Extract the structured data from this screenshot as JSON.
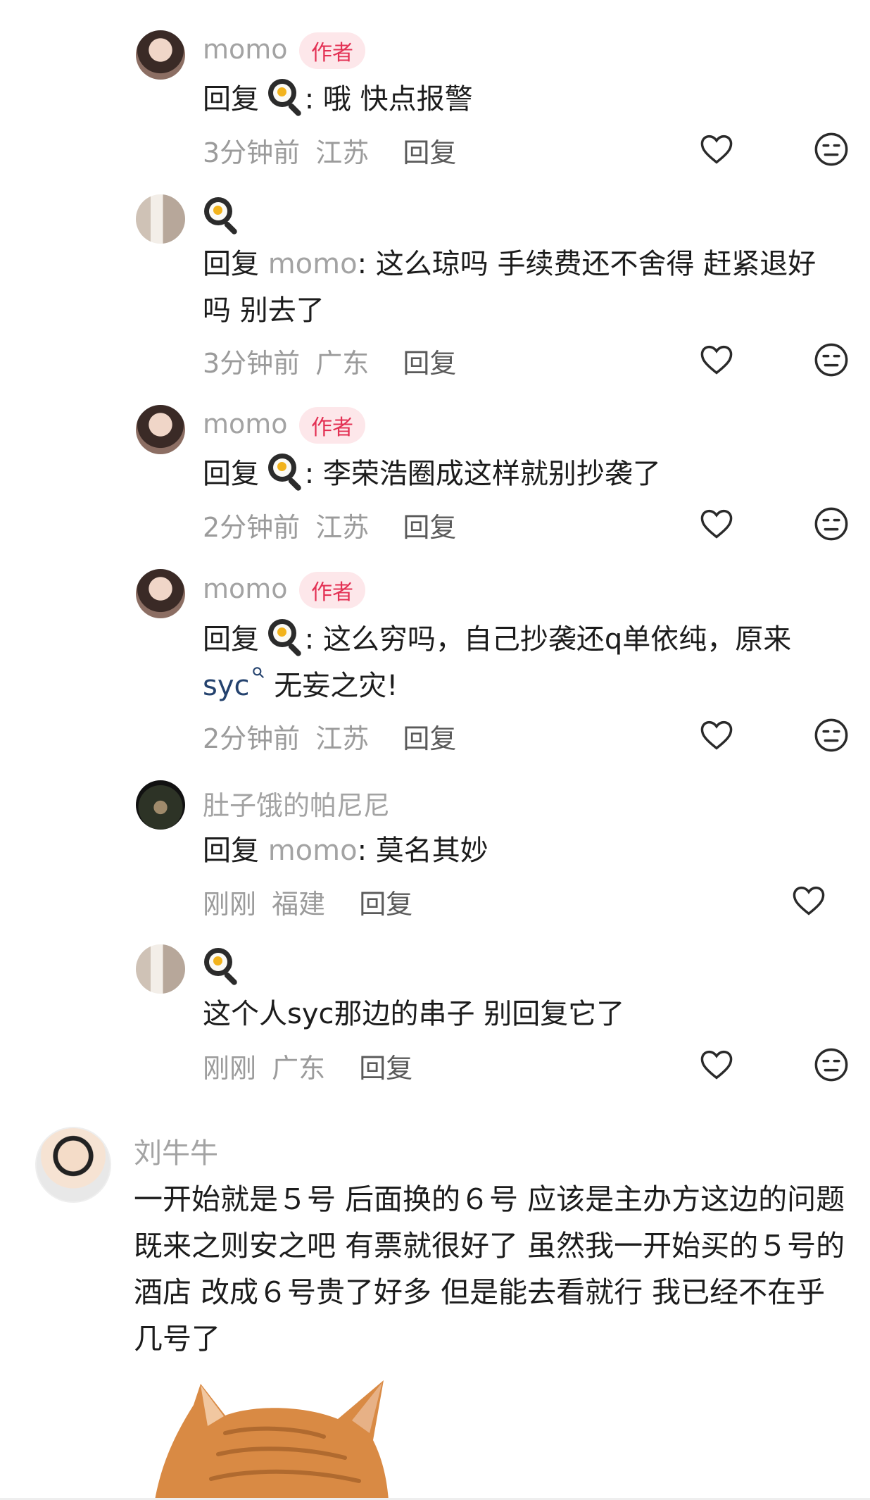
{
  "replies": [
    {
      "name": "momo",
      "author_tag": "作者",
      "prefix": "回复",
      "to": "",
      "sep": ": ",
      "content": "哦 快点报警",
      "time": "3分钟前",
      "location": "江苏",
      "reply_label": "回复"
    },
    {
      "name": "",
      "author_tag": "",
      "prefix": "回复",
      "to": "momo",
      "sep": ": ",
      "content": "这么琼吗 手续费还不舍得 赶紧退好",
      "content2": "吗 别去了",
      "time": "3分钟前",
      "location": "广东",
      "reply_label": "回复"
    },
    {
      "name": "momo",
      "author_tag": "作者",
      "prefix": "回复",
      "to": "",
      "sep": ": ",
      "content": "李荣浩圈成这样就别抄袭了",
      "time": "2分钟前",
      "location": "江苏",
      "reply_label": "回复"
    },
    {
      "name": "momo",
      "author_tag": "作者",
      "prefix": "回复",
      "to": "",
      "sep": ": ",
      "content": "这么穷吗，自己抄袭还q单依纯，原来",
      "link": "syc",
      "content2": " 无妄之灾!",
      "time": "2分钟前",
      "location": "江苏",
      "reply_label": "回复"
    },
    {
      "name": "肚子饿的帕尼尼",
      "author_tag": "",
      "prefix": "回复",
      "to": "momo",
      "sep": ": ",
      "content": "莫名其妙",
      "time": "刚刚",
      "location": "福建",
      "reply_label": "回复"
    },
    {
      "name": "",
      "author_tag": "",
      "prefix": "",
      "to": "",
      "sep": "",
      "content": "这个人syc那边的串子 别回复它了",
      "time": "刚刚",
      "location": "广东",
      "reply_label": "回复"
    }
  ],
  "main_comment": {
    "name": "刘牛牛",
    "lines": [
      "一开始就是５号 后面换的６号 应该是主办方这边的问题",
      "既来之则安之吧 有票就很好了 虽然我一开始买的５号的",
      "酒店 改成６号贵了好多 但是能去看就行 我已经不在乎",
      "几号了"
    ]
  },
  "icons": {
    "like": "heart-outline-icon",
    "dislike": "neutral-face-icon",
    "egg": "fried-egg-pan-icon",
    "search": "search-icon"
  },
  "colors": {
    "author_tag_bg": "#fde7ea",
    "author_tag_text": "#e33154",
    "link": "#24426e",
    "muted": "#a3a3a3"
  }
}
